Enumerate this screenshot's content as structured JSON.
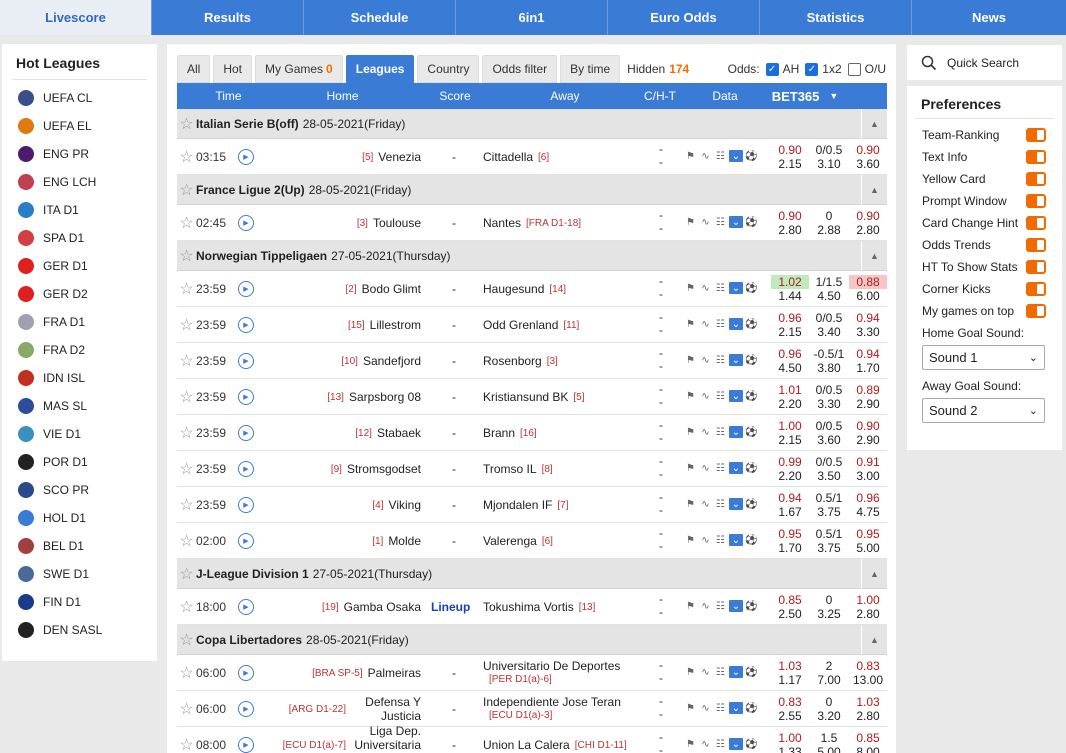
{
  "nav": {
    "tabs": [
      "Livescore",
      "Results",
      "Schedule",
      "6in1",
      "Euro Odds",
      "Statistics",
      "News"
    ],
    "active": 0
  },
  "hot_leagues": {
    "title": "Hot Leagues",
    "items": [
      {
        "label": "UEFA CL",
        "color": "#3a4f8a"
      },
      {
        "label": "UEFA EL",
        "color": "#e07a10"
      },
      {
        "label": "ENG PR",
        "color": "#4b1c6e"
      },
      {
        "label": "ENG LCH",
        "color": "#c04050"
      },
      {
        "label": "ITA D1",
        "color": "#2a7ec8"
      },
      {
        "label": "SPA D1",
        "color": "#d04040"
      },
      {
        "label": "GER D1",
        "color": "#e02020"
      },
      {
        "label": "GER D2",
        "color": "#e02020"
      },
      {
        "label": "FRA D1",
        "color": "#a0a0b0"
      },
      {
        "label": "FRA D2",
        "color": "#88aa66"
      },
      {
        "label": "IDN ISL",
        "color": "#c03020"
      },
      {
        "label": "MAS SL",
        "color": "#2a4e9a"
      },
      {
        "label": "VIE D1",
        "color": "#3a90c0"
      },
      {
        "label": "POR D1",
        "color": "#222222"
      },
      {
        "label": "SCO PR",
        "color": "#2a4a8a"
      },
      {
        "label": "HOL D1",
        "color": "#3a7bd5"
      },
      {
        "label": "BEL D1",
        "color": "#a04040"
      },
      {
        "label": "SWE D1",
        "color": "#4a6a9a"
      },
      {
        "label": "FIN D1",
        "color": "#1a3a8a"
      },
      {
        "label": "DEN SASL",
        "color": "#222222"
      }
    ]
  },
  "filter_tabs": [
    {
      "label": "All",
      "count": ""
    },
    {
      "label": "Hot",
      "count": ""
    },
    {
      "label": "My Games",
      "count": "0"
    },
    {
      "label": "Leagues",
      "count": ""
    },
    {
      "label": "Country",
      "count": ""
    },
    {
      "label": "Odds filter",
      "count": ""
    },
    {
      "label": "By time",
      "count": ""
    }
  ],
  "active_filter": 3,
  "hidden": {
    "label": "Hidden",
    "count": "174"
  },
  "odds_options": {
    "label": "Odds:",
    "items": [
      {
        "label": "AH",
        "checked": true
      },
      {
        "label": "1x2",
        "checked": true
      },
      {
        "label": "O/U",
        "checked": false
      }
    ]
  },
  "table_header": {
    "time": "Time",
    "home": "Home",
    "score": "Score",
    "away": "Away",
    "cht": "C/H-T",
    "data": "Data",
    "bookmaker": "BET365"
  },
  "leagues": [
    {
      "name": "Italian Serie B(off)",
      "date": "28-05-2021(Friday)",
      "matches": [
        {
          "time": "03:15",
          "home_rank": "[5]",
          "home": "Venezia",
          "score": "-",
          "away": "Cittadella",
          "away_rank": "[6]",
          "odds": [
            [
              "0.90",
              "0/0.5",
              "0.90"
            ],
            [
              "2.15",
              "3.10",
              "3.60"
            ]
          ]
        }
      ]
    },
    {
      "name": "France Ligue 2(Up)",
      "date": "28-05-2021(Friday)",
      "matches": [
        {
          "time": "02:45",
          "home_rank": "[3]",
          "home": "Toulouse",
          "score": "-",
          "away": "Nantes",
          "away_rank": "[FRA D1-18]",
          "odds": [
            [
              "0.90",
              "0",
              "0.90"
            ],
            [
              "2.80",
              "2.88",
              "2.80"
            ]
          ]
        }
      ]
    },
    {
      "name": "Norwegian Tippeligaen",
      "date": "27-05-2021(Thursday)",
      "matches": [
        {
          "time": "23:59",
          "home_rank": "[2]",
          "home": "Bodo Glimt",
          "score": "-",
          "away": "Haugesund",
          "away_rank": "[14]",
          "odds": [
            [
              "1.02",
              "1/1.5",
              "0.88"
            ],
            [
              "1.44",
              "4.50",
              "6.00"
            ]
          ],
          "hl": [
            "g",
            "",
            "r"
          ]
        },
        {
          "time": "23:59",
          "home_rank": "[15]",
          "home": "Lillestrom",
          "score": "-",
          "away": "Odd Grenland",
          "away_rank": "[11]",
          "odds": [
            [
              "0.96",
              "0/0.5",
              "0.94"
            ],
            [
              "2.15",
              "3.40",
              "3.30"
            ]
          ]
        },
        {
          "time": "23:59",
          "home_rank": "[10]",
          "home": "Sandefjord",
          "score": "-",
          "away": "Rosenborg",
          "away_rank": "[3]",
          "odds": [
            [
              "0.96",
              "-0.5/1",
              "0.94"
            ],
            [
              "4.50",
              "3.80",
              "1.70"
            ]
          ]
        },
        {
          "time": "23:59",
          "home_rank": "[13]",
          "home": "Sarpsborg 08",
          "score": "-",
          "away": "Kristiansund BK",
          "away_rank": "[5]",
          "odds": [
            [
              "1.01",
              "0/0.5",
              "0.89"
            ],
            [
              "2.20",
              "3.30",
              "2.90"
            ]
          ]
        },
        {
          "time": "23:59",
          "home_rank": "[12]",
          "home": "Stabaek",
          "score": "-",
          "away": "Brann",
          "away_rank": "[16]",
          "odds": [
            [
              "1.00",
              "0/0.5",
              "0.90"
            ],
            [
              "2.15",
              "3.60",
              "2.90"
            ]
          ]
        },
        {
          "time": "23:59",
          "home_rank": "[9]",
          "home": "Stromsgodset",
          "score": "-",
          "away": "Tromso IL",
          "away_rank": "[8]",
          "odds": [
            [
              "0.99",
              "0/0.5",
              "0.91"
            ],
            [
              "2.20",
              "3.50",
              "3.00"
            ]
          ]
        },
        {
          "time": "23:59",
          "home_rank": "[4]",
          "home": "Viking",
          "score": "-",
          "away": "Mjondalen IF",
          "away_rank": "[7]",
          "odds": [
            [
              "0.94",
              "0.5/1",
              "0.96"
            ],
            [
              "1.67",
              "3.75",
              "4.75"
            ]
          ]
        },
        {
          "time": "02:00",
          "home_rank": "[1]",
          "home": "Molde",
          "score": "-",
          "away": "Valerenga",
          "away_rank": "[6]",
          "odds": [
            [
              "0.95",
              "0.5/1",
              "0.95"
            ],
            [
              "1.70",
              "3.75",
              "5.00"
            ]
          ]
        }
      ]
    },
    {
      "name": "J-League Division 1",
      "date": "27-05-2021(Thursday)",
      "matches": [
        {
          "time": "18:00",
          "home_rank": "[19]",
          "home": "Gamba Osaka",
          "score": "",
          "lineup": "Lineup",
          "away": "Tokushima Vortis",
          "away_rank": "[13]",
          "odds": [
            [
              "0.85",
              "0",
              "1.00"
            ],
            [
              "2.50",
              "3.25",
              "2.80"
            ]
          ]
        }
      ]
    },
    {
      "name": "Copa Libertadores",
      "date": "28-05-2021(Friday)",
      "matches": [
        {
          "time": "06:00",
          "home_rank": "[BRA SP-5]",
          "home": "Palmeiras",
          "score": "-",
          "away": "Universitario De Deportes",
          "away_rank": "[PER D1(a)-6]",
          "away_two": true,
          "odds": [
            [
              "1.03",
              "2",
              "0.83"
            ],
            [
              "1.17",
              "7.00",
              "13.00"
            ]
          ]
        },
        {
          "time": "06:00",
          "home_rank": "[ARG D1-22]",
          "home": "Defensa Y Justicia",
          "home_two": true,
          "score": "-",
          "away": "Independiente Jose Teran",
          "away_rank": "[ECU D1(a)-3]",
          "away_two": true,
          "odds": [
            [
              "0.83",
              "0",
              "1.03"
            ],
            [
              "2.55",
              "3.20",
              "2.80"
            ]
          ]
        },
        {
          "time": "08:00",
          "home_rank": "[ECU D1(a)-7]",
          "home": "Liga Dep. Universitaria Quito",
          "home_two": true,
          "score": "-",
          "away": "Union La Calera",
          "away_rank": "[CHI D1-11]",
          "odds": [
            [
              "1.00",
              "1.5",
              "0.85"
            ],
            [
              "1.33",
              "5.00",
              "8.00"
            ]
          ]
        }
      ]
    }
  ],
  "quick_search": "Quick Search",
  "preferences": {
    "title": "Preferences",
    "toggles": [
      "Team-Ranking",
      "Text Info",
      "Yellow Card",
      "Prompt Window",
      "Card Change Hint",
      "Odds Trends",
      "HT To Show Stats",
      "Corner Kicks",
      "My games on top"
    ],
    "home_sound_label": "Home Goal Sound:",
    "home_sound": "Sound 1",
    "away_sound_label": "Away Goal Sound:",
    "away_sound": "Sound 2"
  }
}
